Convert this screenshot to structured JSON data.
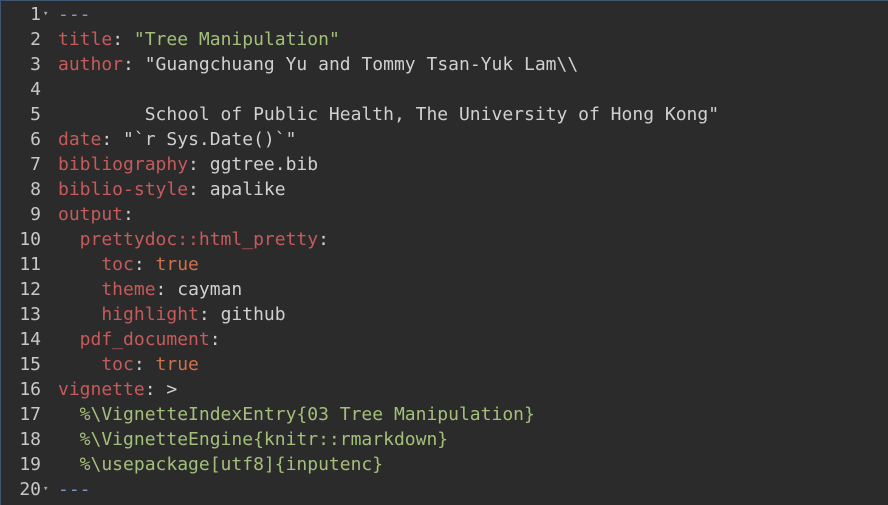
{
  "fold_icon": "▾",
  "lines": [
    {
      "num": "1",
      "fold": true,
      "tokens": [
        {
          "t": "---",
          "c": "dash"
        }
      ]
    },
    {
      "num": "2",
      "tokens": [
        {
          "t": "title",
          "c": "key"
        },
        {
          "t": ": ",
          "c": "punc"
        },
        {
          "t": "\"Tree Manipulation\"",
          "c": "str"
        }
      ]
    },
    {
      "num": "3",
      "tokens": [
        {
          "t": "author",
          "c": "key"
        },
        {
          "t": ": ",
          "c": "punc"
        },
        {
          "t": "\"Guangchuang Yu and Tommy Tsan-Yuk Lam\\\\",
          "c": "plain"
        }
      ]
    },
    {
      "num": "4",
      "tokens": []
    },
    {
      "num": "5",
      "tokens": [
        {
          "t": "        School of Public Health, The University of Hong Kong\"",
          "c": "plain"
        }
      ]
    },
    {
      "num": "6",
      "tokens": [
        {
          "t": "date",
          "c": "key"
        },
        {
          "t": ": ",
          "c": "punc"
        },
        {
          "t": "\"`r Sys.Date()`\"",
          "c": "plain"
        }
      ]
    },
    {
      "num": "7",
      "tokens": [
        {
          "t": "bibliography",
          "c": "key"
        },
        {
          "t": ": ",
          "c": "punc"
        },
        {
          "t": "ggtree.bib",
          "c": "plain"
        }
      ]
    },
    {
      "num": "8",
      "tokens": [
        {
          "t": "biblio-style",
          "c": "key"
        },
        {
          "t": ": ",
          "c": "punc"
        },
        {
          "t": "apalike",
          "c": "plain"
        }
      ]
    },
    {
      "num": "9",
      "tokens": [
        {
          "t": "output",
          "c": "key"
        },
        {
          "t": ":",
          "c": "punc"
        }
      ]
    },
    {
      "num": "10",
      "tokens": [
        {
          "t": "  prettydoc::html_pretty",
          "c": "key"
        },
        {
          "t": ":",
          "c": "punc"
        }
      ]
    },
    {
      "num": "11",
      "tokens": [
        {
          "t": "    toc",
          "c": "key"
        },
        {
          "t": ": ",
          "c": "punc"
        },
        {
          "t": "true",
          "c": "kw"
        }
      ]
    },
    {
      "num": "12",
      "tokens": [
        {
          "t": "    theme",
          "c": "key"
        },
        {
          "t": ": ",
          "c": "punc"
        },
        {
          "t": "cayman",
          "c": "plain"
        }
      ]
    },
    {
      "num": "13",
      "tokens": [
        {
          "t": "    highlight",
          "c": "key"
        },
        {
          "t": ": ",
          "c": "punc"
        },
        {
          "t": "github",
          "c": "plain"
        }
      ]
    },
    {
      "num": "14",
      "tokens": [
        {
          "t": "  pdf_document",
          "c": "key"
        },
        {
          "t": ":",
          "c": "punc"
        }
      ]
    },
    {
      "num": "15",
      "tokens": [
        {
          "t": "    toc",
          "c": "key"
        },
        {
          "t": ": ",
          "c": "punc"
        },
        {
          "t": "true",
          "c": "kw"
        }
      ]
    },
    {
      "num": "16",
      "tokens": [
        {
          "t": "vignette",
          "c": "key"
        },
        {
          "t": ": >",
          "c": "punc"
        }
      ]
    },
    {
      "num": "17",
      "tokens": [
        {
          "t": "  %\\VignetteIndexEntry{03 Tree Manipulation}",
          "c": "str"
        }
      ]
    },
    {
      "num": "18",
      "tokens": [
        {
          "t": "  %\\VignetteEngine{knitr::rmarkdown}",
          "c": "str"
        }
      ]
    },
    {
      "num": "19",
      "tokens": [
        {
          "t": "  %\\usepackage[utf8]{inputenc}",
          "c": "str"
        }
      ]
    },
    {
      "num": "20",
      "fold": true,
      "tokens": [
        {
          "t": "---",
          "c": "dash"
        }
      ]
    }
  ]
}
